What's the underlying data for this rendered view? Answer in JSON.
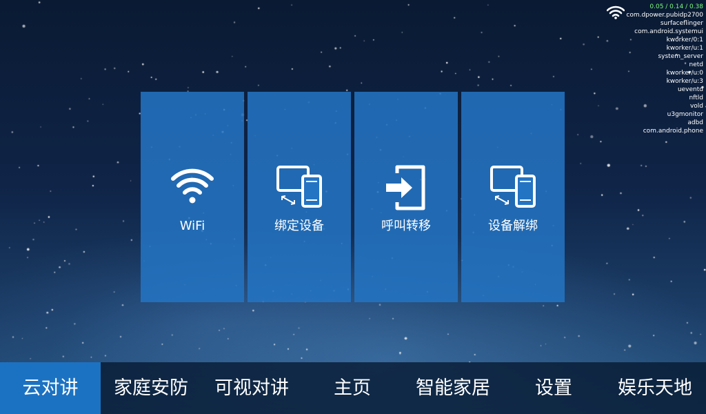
{
  "status": {
    "load": "0.05 / 0.14 / 0.38",
    "processes": [
      "com.dpower.pubidp2700",
      "surfaceflinger",
      "com.android.systemui",
      "kworker/0:1",
      "kworker/u:1",
      "system_server",
      "netd",
      "kworker/u:0",
      "kworker/u:3",
      "ueventd",
      "nftld",
      "vold",
      "u3gmonitor",
      "adbd",
      "com.android.phone"
    ]
  },
  "tiles": [
    {
      "label": "WiFi",
      "icon": "wifi-icon"
    },
    {
      "label": "绑定设备",
      "icon": "devices-link-icon"
    },
    {
      "label": "呼叫转移",
      "icon": "call-forward-icon"
    },
    {
      "label": "设备解绑",
      "icon": "devices-unlink-icon"
    }
  ],
  "nav": {
    "active": "云对讲",
    "items": [
      "云对讲",
      "家庭安防",
      "可视对讲",
      "主页",
      "智能家居",
      "设置",
      "娱乐天地"
    ]
  },
  "colors": {
    "tile": "#2474c4",
    "nav_active": "#1c72c2",
    "nav_bar": "#06182f",
    "load_text": "#7dff7d"
  }
}
